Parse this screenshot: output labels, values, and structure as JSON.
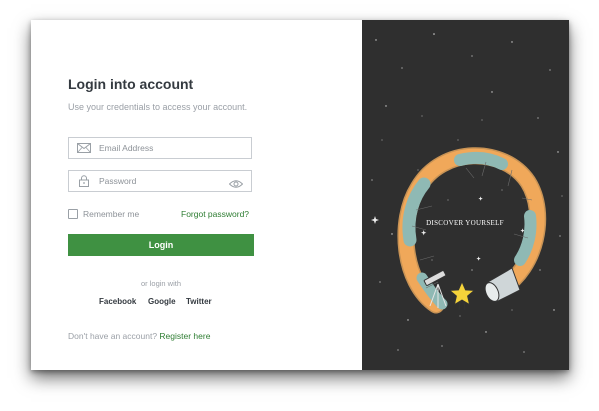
{
  "login": {
    "title": "Login into account",
    "subtitle": "Use your credentials to access your account.",
    "email_placeholder": "Email Address",
    "password_placeholder": "Password",
    "remember_label": "Remember me",
    "forgot_label": "Forgot password?",
    "login_button": "Login",
    "or_login_with": "or login with",
    "social": [
      "Facebook",
      "Google",
      "Twitter"
    ],
    "no_account_text": "Don't have an account?",
    "register_link": "Register here"
  },
  "illustration": {
    "caption": "DISCOVER YOURSELF",
    "icons": [
      "telescope-icon",
      "star-icon",
      "spyglass-icon"
    ]
  },
  "colors": {
    "accent_green": "#3f9142",
    "link_green": "#2e7d32",
    "panel_dark": "#2f2f2f",
    "title_text": "#343a40"
  }
}
